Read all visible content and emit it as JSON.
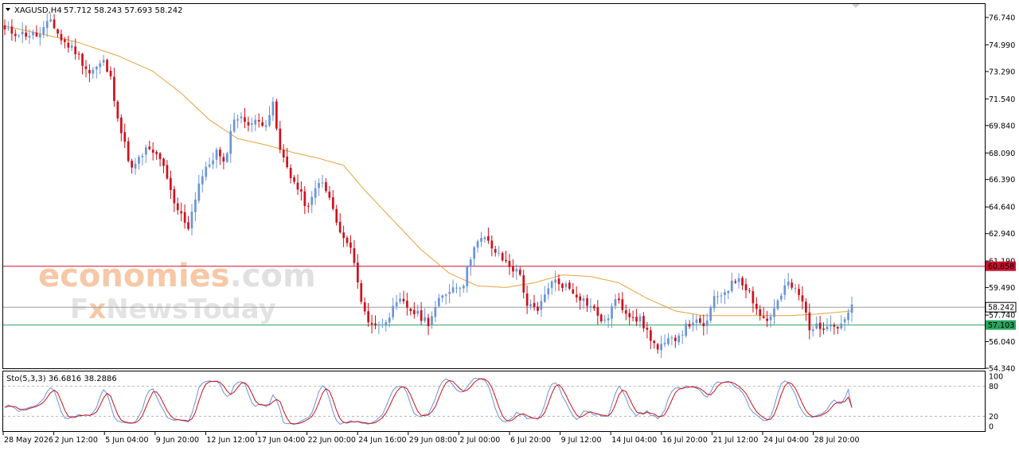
{
  "header": {
    "symbol": "XAGUSD,H4",
    "ohlc": "57.712 58.243 57.693 58.242"
  },
  "watermark": {
    "brand": "economies",
    "brand_suffix": ".com",
    "sub_prefix": "F",
    "sub_x": "x",
    "sub_rest": "NewsToday"
  },
  "colors": {
    "bull": "#6b94d8",
    "bear": "#d0101c",
    "ma": "#e6a23c",
    "resistance": "#c8102e",
    "support": "#27a55e",
    "current": "#9e9e9e",
    "stoch_main": "#6b94d8",
    "stoch_signal": "#d0101c"
  },
  "chart_data": {
    "type": "candlestick",
    "symbol": "XAGUSD",
    "timeframe": "H4",
    "price_axis": {
      "labels": [
        "76.740",
        "74.990",
        "73.290",
        "71.540",
        "69.840",
        "68.090",
        "66.390",
        "64.640",
        "62.940",
        "61.190",
        "59.490",
        "57.740",
        "56.040",
        "54.340"
      ],
      "range": [
        54.34,
        77.6
      ]
    },
    "time_axis_labels": [
      "28 May 2026",
      "2 Jun 12:00",
      "5 Jun 04:00",
      "9 Jun 20:00",
      "12 Jun 12:00",
      "17 Jun 04:00",
      "22 Jun 00:00",
      "24 Jun 16:00",
      "29 Jun 08:00",
      "2 Jul 00:00",
      "6 Jul 20:00",
      "9 Jul 12:00",
      "14 Jul 04:00",
      "16 Jul 20:00",
      "21 Jul 12:00",
      "24 Jul 04:00",
      "28 Jul 20:00"
    ],
    "levels": [
      {
        "name": "resistance",
        "value": 60.858,
        "label": "60.858"
      },
      {
        "name": "current",
        "value": 58.242,
        "label": "58.242"
      },
      {
        "name": "support",
        "value": 57.103,
        "label": "57.103"
      }
    ],
    "close_waypoints": [
      [
        0,
        75.9
      ],
      [
        5,
        75.7
      ],
      [
        10,
        75.6
      ],
      [
        13,
        76.6
      ],
      [
        16,
        75.3
      ],
      [
        20,
        74.6
      ],
      [
        24,
        73.2
      ],
      [
        28,
        73.9
      ],
      [
        30,
        72.8
      ],
      [
        33,
        69.4
      ],
      [
        36,
        67.0
      ],
      [
        40,
        68.3
      ],
      [
        44,
        67.8
      ],
      [
        48,
        64.8
      ],
      [
        52,
        63.4
      ],
      [
        55,
        66.2
      ],
      [
        60,
        68.2
      ],
      [
        62,
        67.3
      ],
      [
        65,
        70.4
      ],
      [
        70,
        70.0
      ],
      [
        74,
        70.1
      ],
      [
        76,
        71.1
      ],
      [
        78,
        68.2
      ],
      [
        82,
        66.2
      ],
      [
        86,
        64.5
      ],
      [
        89,
        66.4
      ],
      [
        92,
        65.2
      ],
      [
        95,
        62.9
      ],
      [
        97,
        62.3
      ],
      [
        99,
        61.3
      ],
      [
        101,
        58.5
      ],
      [
        103,
        57.4
      ],
      [
        106,
        57.0
      ],
      [
        109,
        57.8
      ],
      [
        112,
        58.6
      ],
      [
        116,
        57.9
      ],
      [
        120,
        57.3
      ],
      [
        123,
        58.6
      ],
      [
        126,
        59.4
      ],
      [
        130,
        59.8
      ],
      [
        133,
        62.3
      ],
      [
        136,
        62.6
      ],
      [
        140,
        61.5
      ],
      [
        144,
        60.7
      ],
      [
        146,
        60.3
      ],
      [
        148,
        58.4
      ],
      [
        151,
        57.9
      ],
      [
        154,
        59.6
      ],
      [
        156,
        59.9
      ],
      [
        159,
        59.6
      ],
      [
        163,
        58.9
      ],
      [
        166,
        58.3
      ],
      [
        170,
        57.2
      ],
      [
        173,
        58.7
      ],
      [
        176,
        58.0
      ],
      [
        180,
        57.4
      ],
      [
        183,
        56.3
      ],
      [
        185,
        55.5
      ],
      [
        188,
        56.0
      ],
      [
        191,
        56.5
      ],
      [
        195,
        57.4
      ],
      [
        198,
        56.9
      ],
      [
        201,
        58.7
      ],
      [
        204,
        59.3
      ],
      [
        206,
        59.7
      ],
      [
        208,
        60.2
      ],
      [
        211,
        59.2
      ],
      [
        214,
        57.7
      ],
      [
        216,
        57.4
      ],
      [
        218,
        58.1
      ],
      [
        220,
        59.0
      ],
      [
        222,
        59.8
      ],
      [
        224,
        59.3
      ],
      [
        226,
        58.6
      ],
      [
        228,
        57.0
      ],
      [
        231,
        56.9
      ],
      [
        234,
        57.4
      ],
      [
        236,
        56.9
      ],
      [
        238,
        57.6
      ],
      [
        240,
        58.2
      ]
    ],
    "ma_waypoints": [
      [
        0,
        76.2
      ],
      [
        20,
        75.2
      ],
      [
        32,
        74.3
      ],
      [
        42,
        73.3
      ],
      [
        50,
        71.9
      ],
      [
        58,
        70.2
      ],
      [
        66,
        69.0
      ],
      [
        74,
        68.6
      ],
      [
        82,
        68.1
      ],
      [
        88,
        67.8
      ],
      [
        96,
        67.3
      ],
      [
        102,
        65.7
      ],
      [
        110,
        63.8
      ],
      [
        118,
        61.9
      ],
      [
        126,
        60.4
      ],
      [
        134,
        59.6
      ],
      [
        142,
        59.5
      ],
      [
        150,
        59.8
      ],
      [
        158,
        60.3
      ],
      [
        166,
        60.2
      ],
      [
        174,
        59.8
      ],
      [
        182,
        58.8
      ],
      [
        190,
        58.0
      ],
      [
        198,
        57.7
      ],
      [
        206,
        57.7
      ],
      [
        214,
        57.7
      ],
      [
        222,
        57.7
      ],
      [
        230,
        57.8
      ],
      [
        240,
        58.0
      ]
    ],
    "stochastic": {
      "label": "Sto(5,3,3) 36.6816 38.2886",
      "main": 36.6816,
      "signal": 38.2886,
      "range": [
        0,
        100
      ],
      "levels": [
        20,
        80
      ],
      "axis_labels": [
        "100",
        "80",
        "20",
        "0"
      ]
    }
  }
}
